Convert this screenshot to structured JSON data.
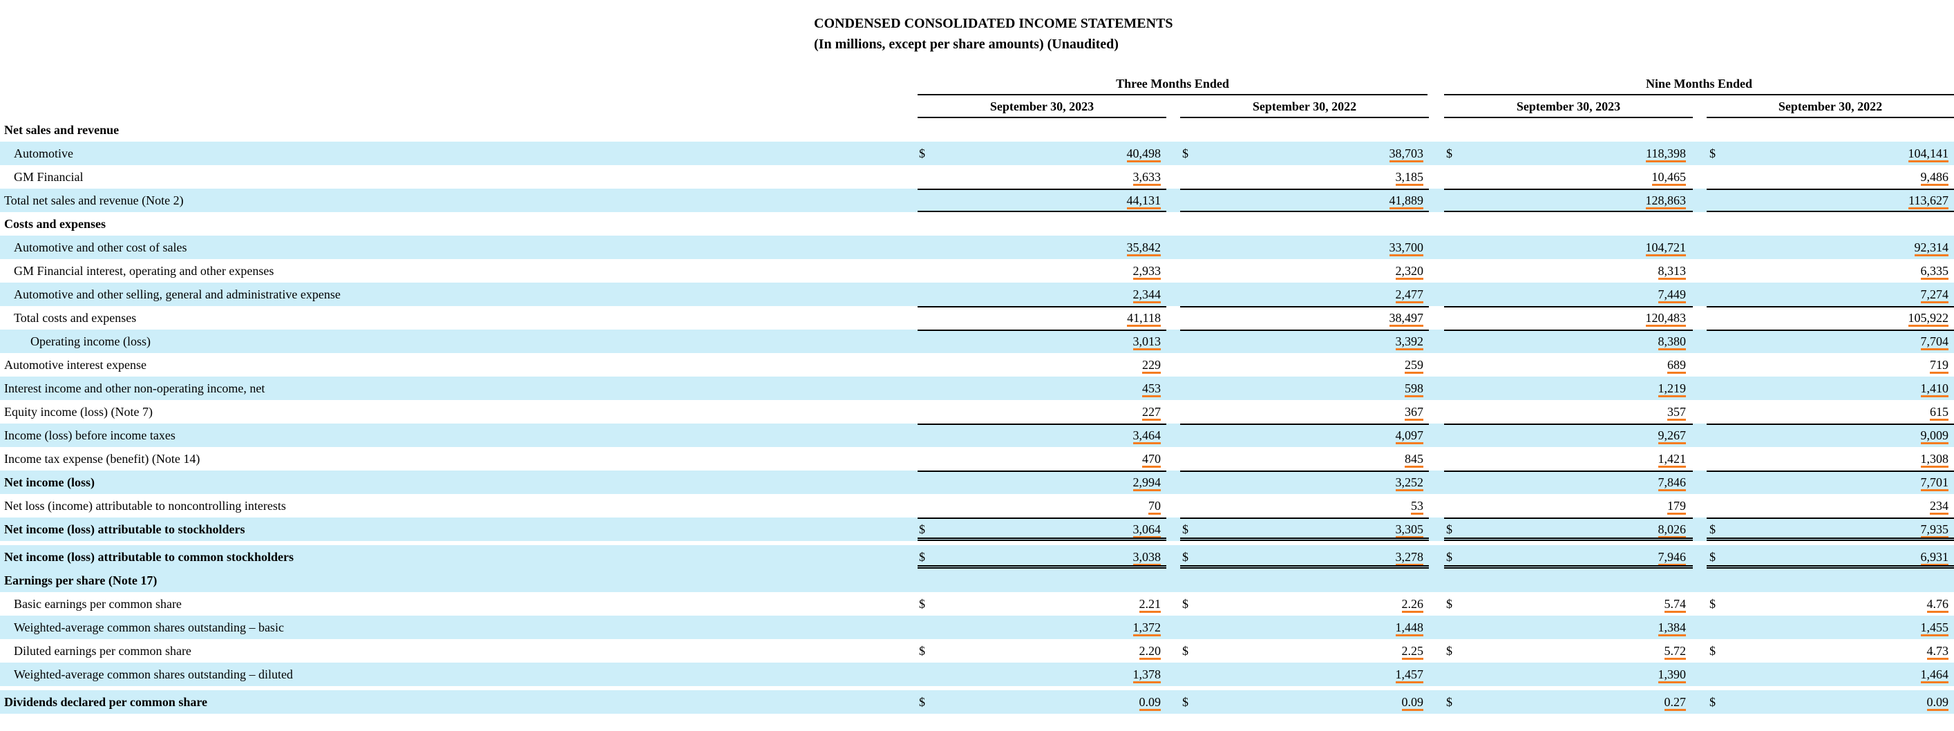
{
  "header": {
    "title": "CONDENSED CONSOLIDATED INCOME STATEMENTS",
    "subtitle": "(In millions, except per share amounts) (Unaudited)"
  },
  "periods": {
    "three_months": "Three Months Ended",
    "nine_months": "Nine Months Ended"
  },
  "columns": [
    "September 30, 2023",
    "September 30, 2022",
    "September 30, 2023",
    "September 30, 2022"
  ],
  "currency_symbol": "$",
  "accent_color": "#f47c20",
  "shade_color": "#cdeef9",
  "rows": [
    {
      "label": "Net sales and revenue",
      "bold": true,
      "indent": 0,
      "shade": false,
      "values": null,
      "dollar": false
    },
    {
      "label": "Automotive",
      "bold": false,
      "indent": 1,
      "shade": true,
      "values": [
        "40,498",
        "38,703",
        "118,398",
        "104,141"
      ],
      "dollar": true
    },
    {
      "label": "GM Financial",
      "bold": false,
      "indent": 1,
      "shade": false,
      "values": [
        "3,633",
        "3,185",
        "10,465",
        "9,486"
      ],
      "dollar": false
    },
    {
      "label": "Total net sales and revenue (Note 2)",
      "bold": false,
      "indent": 0,
      "shade": true,
      "values": [
        "44,131",
        "41,889",
        "128,863",
        "113,627"
      ],
      "dollar": false,
      "top_rule": true,
      "bottom_rule": true
    },
    {
      "label": "Costs and expenses",
      "bold": true,
      "indent": 0,
      "shade": false,
      "values": null,
      "dollar": false
    },
    {
      "label": "Automotive and other cost of sales",
      "bold": false,
      "indent": 1,
      "shade": true,
      "values": [
        "35,842",
        "33,700",
        "104,721",
        "92,314"
      ],
      "dollar": false
    },
    {
      "label": "GM Financial interest, operating and other expenses",
      "bold": false,
      "indent": 1,
      "shade": false,
      "values": [
        "2,933",
        "2,320",
        "8,313",
        "6,335"
      ],
      "dollar": false
    },
    {
      "label": "Automotive and other selling, general and administrative expense",
      "bold": false,
      "indent": 1,
      "shade": true,
      "values": [
        "2,344",
        "2,477",
        "7,449",
        "7,274"
      ],
      "dollar": false
    },
    {
      "label": "Total costs and expenses",
      "bold": false,
      "indent": 1,
      "shade": false,
      "values": [
        "41,118",
        "38,497",
        "120,483",
        "105,922"
      ],
      "dollar": false,
      "top_rule": true
    },
    {
      "label": "Operating income (loss)",
      "bold": false,
      "indent": 2,
      "shade": true,
      "values": [
        "3,013",
        "3,392",
        "8,380",
        "7,704"
      ],
      "dollar": false,
      "top_rule": true
    },
    {
      "label": "Automotive interest expense",
      "bold": false,
      "indent": 0,
      "shade": false,
      "values": [
        "229",
        "259",
        "689",
        "719"
      ],
      "dollar": false
    },
    {
      "label": "Interest income and other non-operating income, net",
      "bold": false,
      "indent": 0,
      "shade": true,
      "values": [
        "453",
        "598",
        "1,219",
        "1,410"
      ],
      "dollar": false
    },
    {
      "label": "Equity income (loss) (Note 7)",
      "bold": false,
      "indent": 0,
      "shade": false,
      "values": [
        "227",
        "367",
        "357",
        "615"
      ],
      "dollar": false
    },
    {
      "label": "Income (loss) before income taxes",
      "bold": false,
      "indent": 0,
      "shade": true,
      "values": [
        "3,464",
        "4,097",
        "9,267",
        "9,009"
      ],
      "dollar": false,
      "top_rule": true
    },
    {
      "label": "Income tax expense (benefit) (Note 14)",
      "bold": false,
      "indent": 0,
      "shade": false,
      "values": [
        "470",
        "845",
        "1,421",
        "1,308"
      ],
      "dollar": false
    },
    {
      "label": "Net income (loss)",
      "bold": true,
      "indent": 0,
      "shade": true,
      "values": [
        "2,994",
        "3,252",
        "7,846",
        "7,701"
      ],
      "dollar": false,
      "top_rule": true
    },
    {
      "label": "Net loss (income) attributable to noncontrolling interests",
      "bold": false,
      "indent": 0,
      "shade": false,
      "values": [
        "70",
        "53",
        "179",
        "234"
      ],
      "dollar": false
    },
    {
      "label": "Net income (loss) attributable to stockholders",
      "bold": true,
      "indent": 0,
      "shade": true,
      "values": [
        "3,064",
        "3,305",
        "8,026",
        "7,935"
      ],
      "dollar": true,
      "top_rule": true,
      "bottom_double": true
    },
    {
      "gap": true
    },
    {
      "label": "Net income (loss) attributable to common stockholders",
      "bold": true,
      "indent": 0,
      "shade": true,
      "values": [
        "3,038",
        "3,278",
        "7,946",
        "6,931"
      ],
      "dollar": true,
      "bottom_double": true
    },
    {
      "label": "Earnings per share (Note 17)",
      "bold": true,
      "indent": 0,
      "shade": true,
      "values": null,
      "dollar": false
    },
    {
      "label": "Basic earnings per common share",
      "bold": false,
      "indent": 1,
      "shade": false,
      "values": [
        "2.21",
        "2.26",
        "5.74",
        "4.76"
      ],
      "dollar": true
    },
    {
      "label": "Weighted-average common shares outstanding – basic",
      "bold": false,
      "indent": 1,
      "shade": true,
      "values": [
        "1,372",
        "1,448",
        "1,384",
        "1,455"
      ],
      "dollar": false
    },
    {
      "label": "Diluted earnings per common share",
      "bold": false,
      "indent": 1,
      "shade": false,
      "values": [
        "2.20",
        "2.25",
        "5.72",
        "4.73"
      ],
      "dollar": true
    },
    {
      "label": "Weighted-average common shares outstanding – diluted",
      "bold": false,
      "indent": 1,
      "shade": true,
      "values": [
        "1,378",
        "1,457",
        "1,390",
        "1,464"
      ],
      "dollar": false
    },
    {
      "gap": true
    },
    {
      "label": "Dividends declared per common share",
      "bold": true,
      "indent": 0,
      "shade": true,
      "values": [
        "0.09",
        "0.09",
        "0.27",
        "0.09"
      ],
      "dollar": true
    }
  ]
}
